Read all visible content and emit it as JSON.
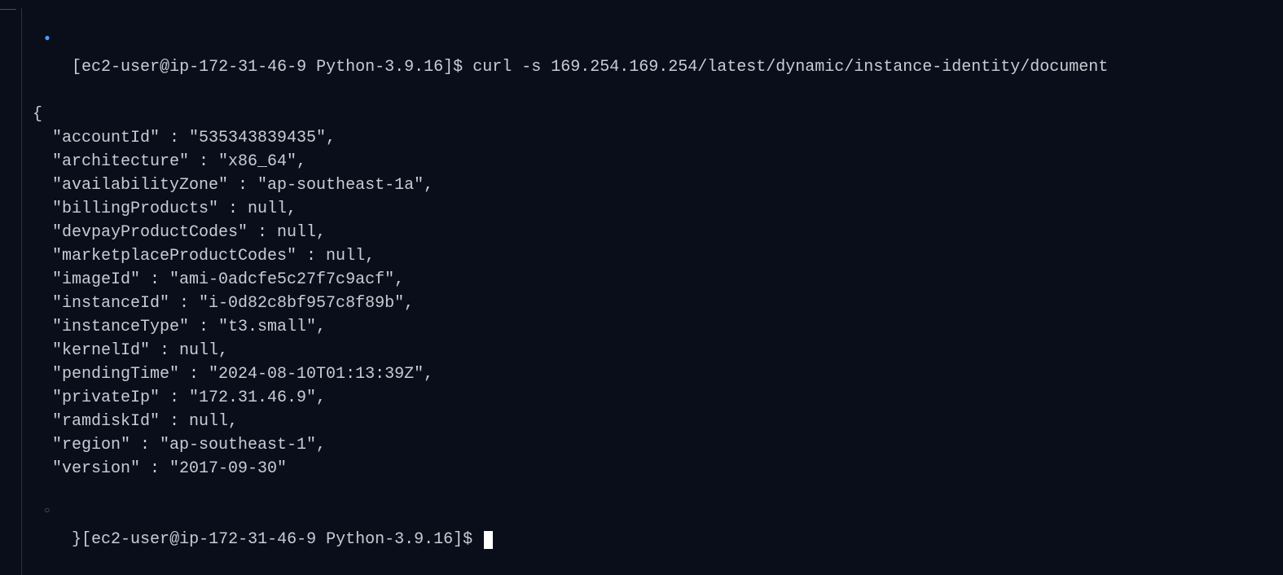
{
  "prompt1": {
    "user": "ec2-user",
    "host": "ip-172-31-46-9",
    "dir": "Python-3.9.16",
    "symbol": "$"
  },
  "command": "curl -s 169.254.169.254/latest/dynamic/instance-identity/document",
  "json_output": {
    "open_brace": "{",
    "close_brace": "}",
    "lines": [
      "  \"accountId\" : \"535343839435\",",
      "  \"architecture\" : \"x86_64\",",
      "  \"availabilityZone\" : \"ap-southeast-1a\",",
      "  \"billingProducts\" : null,",
      "  \"devpayProductCodes\" : null,",
      "  \"marketplaceProductCodes\" : null,",
      "  \"imageId\" : \"ami-0adcfe5c27f7c9acf\",",
      "  \"instanceId\" : \"i-0d82c8bf957c8f89b\",",
      "  \"instanceType\" : \"t3.small\",",
      "  \"kernelId\" : null,",
      "  \"pendingTime\" : \"2024-08-10T01:13:39Z\",",
      "  \"privateIp\" : \"172.31.46.9\",",
      "  \"ramdiskId\" : null,",
      "  \"region\" : \"ap-southeast-1\",",
      "  \"version\" : \"2017-09-30\""
    ]
  },
  "prompt2": {
    "user": "ec2-user",
    "host": "ip-172-31-46-9",
    "dir": "Python-3.9.16",
    "symbol": "$"
  },
  "gutter": {
    "filled": "●",
    "hollow": "○"
  }
}
